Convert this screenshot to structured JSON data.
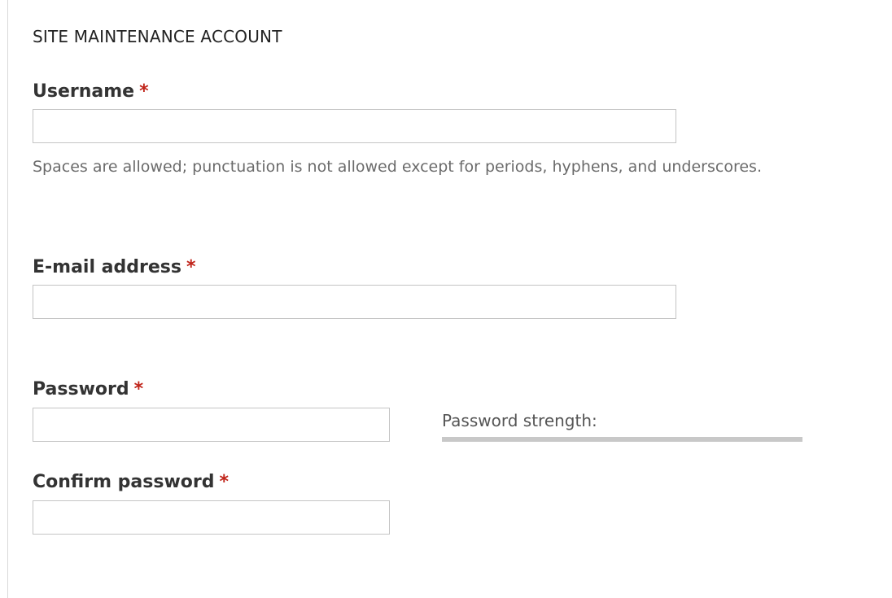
{
  "section": {
    "title": "SITE MAINTENANCE ACCOUNT"
  },
  "required_marker": "*",
  "fields": {
    "username": {
      "label": "Username",
      "value": "",
      "help": "Spaces are allowed; punctuation is not allowed except for periods, hyphens, and underscores."
    },
    "email": {
      "label": "E-mail address",
      "value": ""
    },
    "password": {
      "label": "Password",
      "value": ""
    },
    "confirm_password": {
      "label": "Confirm password",
      "value": ""
    }
  },
  "password_strength": {
    "label": "Password strength:",
    "level_percent": 0
  },
  "colors": {
    "required": "#c0241a",
    "strength_track": "#c8c8c8",
    "help_text": "#6b6b6b"
  }
}
